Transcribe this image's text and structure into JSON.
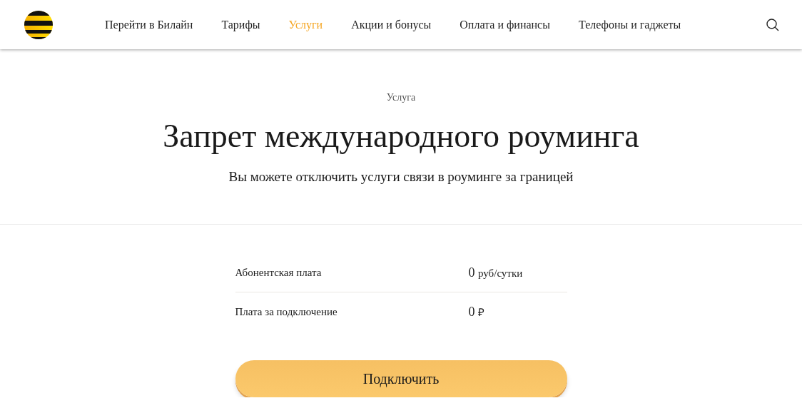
{
  "header": {
    "nav": [
      {
        "label": "Перейти в Билайн",
        "selected": false
      },
      {
        "label": "Тарифы",
        "selected": false
      },
      {
        "label": "Услуги",
        "selected": true
      },
      {
        "label": "Акции и бонусы",
        "selected": false
      },
      {
        "label": "Оплата и финансы",
        "selected": false
      },
      {
        "label": "Телефоны и гаджеты",
        "selected": false
      }
    ]
  },
  "hero": {
    "eyebrow": "Услуга",
    "title": "Запрет международного роуминга",
    "subtitle": "Вы можете отключить услуги связи в роуминге за границей"
  },
  "prices": [
    {
      "label": "Абонентская плата",
      "amount": "0",
      "unit": "руб/сутки"
    },
    {
      "label": "Плата за подключение",
      "amount": "0",
      "unit": "₽"
    }
  ],
  "button": "Подключить"
}
